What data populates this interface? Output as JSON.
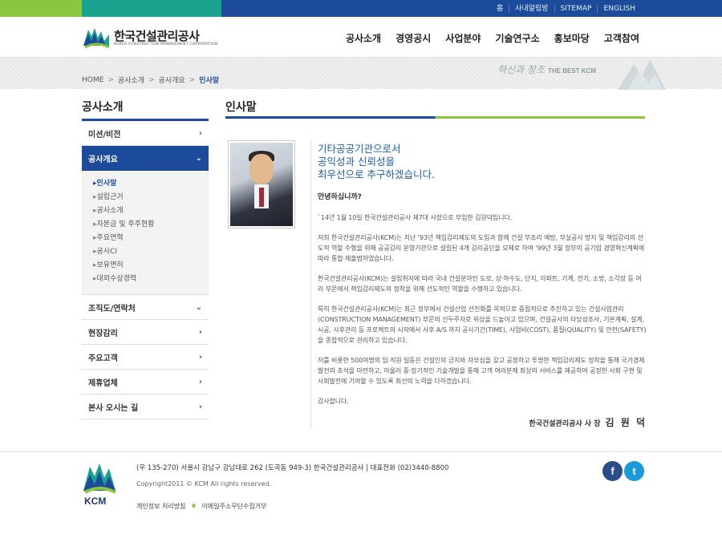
{
  "top_util": {
    "links": [
      "홈",
      "사내알림방",
      "SITEMAP",
      "ENGLISH"
    ]
  },
  "header": {
    "logo_ko": "한국건설관리공사",
    "logo_en": "KOREA CONSTRUCTION MANAGEMENT CORPORATION",
    "nav": [
      "공사소개",
      "경영공시",
      "사업분야",
      "기술연구소",
      "홍보마당",
      "고객참여"
    ]
  },
  "breadcrumb": {
    "items": [
      "HOME",
      "공사소개",
      "공사개요"
    ],
    "current": "인사말"
  },
  "band": {
    "slogan": "혁신과 창조",
    "tag": "THE BEST KCM"
  },
  "sidebar": {
    "title": "공사소개",
    "items_before": [
      {
        "label": "미션/비전"
      }
    ],
    "active": {
      "label": "공사개요"
    },
    "sub_items": [
      "인사말",
      "설립근거",
      "공사소개",
      "자본금 및 주주현황",
      "주요연혁",
      "공사CI",
      "보유면허",
      "대외수상경력"
    ],
    "items_after": [
      {
        "label": "조직도/연락처",
        "chevron": "down"
      },
      {
        "label": "현장감리"
      },
      {
        "label": "주요고객"
      },
      {
        "label": "제휴업체"
      },
      {
        "label": "본사 오시는 길"
      }
    ]
  },
  "content": {
    "title": "인사말",
    "headline": [
      "기타공공기관으로서",
      "공익성과 신뢰성을",
      "최우선으로 추구하겠습니다."
    ],
    "greeting": "안녕하십니까?",
    "paragraphs": [
      "`14년 1월 10일 한국건설관리공사 제7대 사장으로 부임한 김원덕입니다.",
      "저희 한국건설관리공사(KCM)는 지난 '93년 책임감리제도의 도입과 함께 건설 부조리 예방, 부실공사 방지 및 책임감리의 선도적 역할 수행을 위해 공공감리 운영기관으로 설립된 4개 감리공단을 모체로 하여 '99년 3월 정부의 공기업 경영혁신계획에 따라 통합·재출범하였습니다.",
      "한국건설관리공사(KCM)는 설립취지에 따라 국내 건설분야인 도로, 상·하수도, 단지, 아파트, 기계, 전기, 소방, 소각장 등 여러 부문에서 책임감리제도의 정착을 위해 선도적인 역할을 수행하고 있습니다.",
      "특히 한국건설관리공사(KCM)는 최근 정부에서 건설산업 선진화를 목적으로 중점적으로 추진하고 있는 건설사업관리(CONSTRUCTION MANAGEMENT) 부문의 선두주자로 위상을 드높이고 있으며, 건설공사의 타당성조사, 기본계획, 설계, 시공, 사후관리 등 프로젝트의 시작에서 사후 A/S 까지 공사기간(TIME), 사업비(COST), 품질(QUALITY) 및 안전(SAFETY)을 종합적으로 관리하고 있습니다.",
      "저를 비롯한 500여명의 임·직원 일동은 건설인의 긍지와 자부심을 갖고 공정하고 투명한 책임감리제도 정착을 통해 국가경제 발전의 초석을 마련하고, 아울러 중·장기적인 기술개발을 통해 고객 여러분께 최상의 서비스를 제공하여 공정한 사회 구현 및 사회발전에 기여할 수 있도록 최선의 노력을 다하겠습니다.",
      "감사합니다."
    ],
    "signature_title": "한국건설관리공사 사 장",
    "signature_name": "김 원 덕"
  },
  "footer": {
    "logo_text": "KCM",
    "address": "(우 135-270) 서울시 강남구 강남대로 262 (도곡동 949-3) 한국건설관리공사 | 대표전화 (02)3440-8800",
    "copyright": "Copyright2011 © KCM All rights reserved.",
    "links": [
      "개인정보 처리방침",
      "이메일주소무단수집거부"
    ],
    "sns": [
      "f",
      "t"
    ]
  },
  "colors": {
    "primary": "#1b4b9a",
    "green": "#8cc63f",
    "teal": "#1aa38f",
    "headline": "#1b5ea8",
    "facebook": "#2c4c8c",
    "twitter": "#1a9ad6"
  }
}
